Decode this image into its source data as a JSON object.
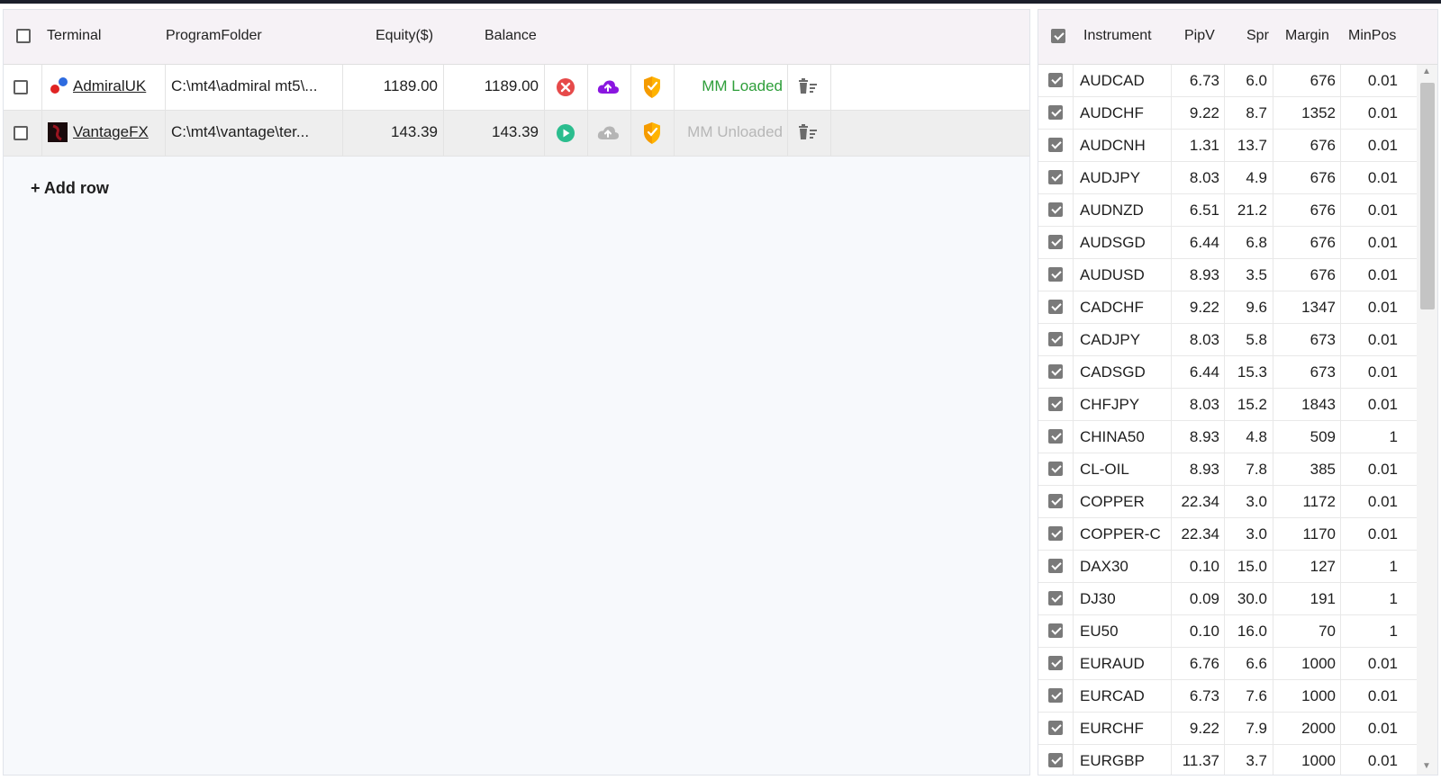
{
  "terminals": {
    "headers": {
      "terminal": "Terminal",
      "program_folder": "ProgramFolder",
      "equity": "Equity($)",
      "balance": "Balance"
    },
    "rows": [
      {
        "name": "AdmiralUK",
        "logo": "admiral-logo-icon",
        "folder": "C:\\mt4\\admiral mt5\\...",
        "equity": "1189.00",
        "balance": "1189.00",
        "action_icon": "stop-icon",
        "cloud_icon": "cloud-upload-icon",
        "shield_icon": "shield-icon",
        "status": "MM Loaded",
        "delete_icon": "delete-list-icon"
      },
      {
        "name": "VantageFX",
        "logo": "vantage-logo-icon",
        "folder": "C:\\mt4\\vantage\\ter...",
        "equity": "143.39",
        "balance": "143.39",
        "action_icon": "play-icon",
        "cloud_icon": "cloud-upload-icon",
        "shield_icon": "shield-icon",
        "status": "MM Unloaded",
        "delete_icon": "delete-list-icon"
      }
    ],
    "add_row": "+ Add row"
  },
  "instruments": {
    "headers": {
      "instrument": "Instrument",
      "pipv": "PipV",
      "spr": "Spr",
      "margin": "Margin",
      "minpos": "MinPos"
    },
    "rows": [
      {
        "name": "AUDCAD",
        "pipv": "6.73",
        "spr": "6.0",
        "margin": "676",
        "minpos": "0.01"
      },
      {
        "name": "AUDCHF",
        "pipv": "9.22",
        "spr": "8.7",
        "margin": "1352",
        "minpos": "0.01"
      },
      {
        "name": "AUDCNH",
        "pipv": "1.31",
        "spr": "13.7",
        "margin": "676",
        "minpos": "0.01"
      },
      {
        "name": "AUDJPY",
        "pipv": "8.03",
        "spr": "4.9",
        "margin": "676",
        "minpos": "0.01"
      },
      {
        "name": "AUDNZD",
        "pipv": "6.51",
        "spr": "21.2",
        "margin": "676",
        "minpos": "0.01"
      },
      {
        "name": "AUDSGD",
        "pipv": "6.44",
        "spr": "6.8",
        "margin": "676",
        "minpos": "0.01"
      },
      {
        "name": "AUDUSD",
        "pipv": "8.93",
        "spr": "3.5",
        "margin": "676",
        "minpos": "0.01"
      },
      {
        "name": "CADCHF",
        "pipv": "9.22",
        "spr": "9.6",
        "margin": "1347",
        "minpos": "0.01"
      },
      {
        "name": "CADJPY",
        "pipv": "8.03",
        "spr": "5.8",
        "margin": "673",
        "minpos": "0.01"
      },
      {
        "name": "CADSGD",
        "pipv": "6.44",
        "spr": "15.3",
        "margin": "673",
        "minpos": "0.01"
      },
      {
        "name": "CHFJPY",
        "pipv": "8.03",
        "spr": "15.2",
        "margin": "1843",
        "minpos": "0.01"
      },
      {
        "name": "CHINA50",
        "pipv": "8.93",
        "spr": "4.8",
        "margin": "509",
        "minpos": "1"
      },
      {
        "name": "CL-OIL",
        "pipv": "8.93",
        "spr": "7.8",
        "margin": "385",
        "minpos": "0.01"
      },
      {
        "name": "COPPER",
        "pipv": "22.34",
        "spr": "3.0",
        "margin": "1172",
        "minpos": "0.01"
      },
      {
        "name": "COPPER-C",
        "pipv": "22.34",
        "spr": "3.0",
        "margin": "1170",
        "minpos": "0.01"
      },
      {
        "name": "DAX30",
        "pipv": "0.10",
        "spr": "15.0",
        "margin": "127",
        "minpos": "1"
      },
      {
        "name": "DJ30",
        "pipv": "0.09",
        "spr": "30.0",
        "margin": "191",
        "minpos": "1"
      },
      {
        "name": "EU50",
        "pipv": "0.10",
        "spr": "16.0",
        "margin": "70",
        "minpos": "1"
      },
      {
        "name": "EURAUD",
        "pipv": "6.76",
        "spr": "6.6",
        "margin": "1000",
        "minpos": "0.01"
      },
      {
        "name": "EURCAD",
        "pipv": "6.73",
        "spr": "7.6",
        "margin": "1000",
        "minpos": "0.01"
      },
      {
        "name": "EURCHF",
        "pipv": "9.22",
        "spr": "7.9",
        "margin": "2000",
        "minpos": "0.01"
      },
      {
        "name": "EURGBP",
        "pipv": "11.37",
        "spr": "3.7",
        "margin": "1000",
        "minpos": "0.01"
      }
    ]
  },
  "colors": {
    "stop": "#e64a4a",
    "play": "#2bbd8e",
    "cloud_active": "#8a16e0",
    "cloud_inactive": "#b5b5b5",
    "shield": "#ffb300",
    "loaded": "#2e9e3a",
    "unloaded": "#b7b7b7"
  }
}
